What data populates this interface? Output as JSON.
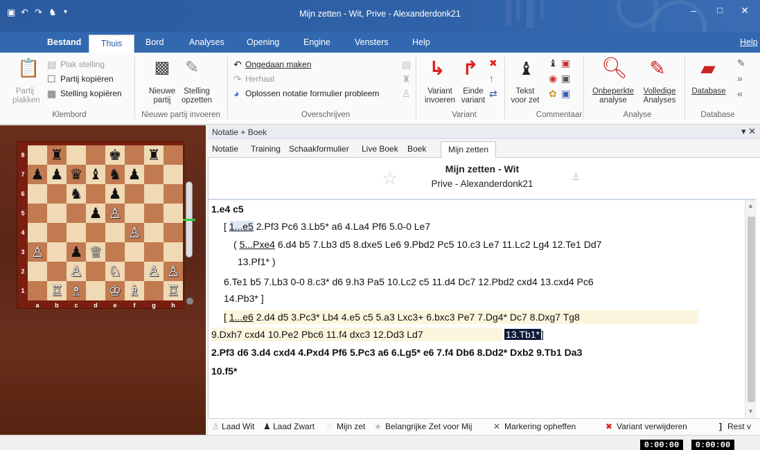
{
  "window": {
    "title": "Mijn zetten - Wit, Prive - Alexanderdonk21",
    "controls": [
      "–",
      "□",
      "✕"
    ]
  },
  "ribbon_tabs": [
    "Bestand",
    "Thuis",
    "Bord",
    "Analyses",
    "Opening",
    "Engine",
    "Vensters",
    "Help"
  ],
  "ribbon_help": "Help",
  "ribbon": {
    "klembord": {
      "label": "Klembord",
      "partij_plakken": [
        "Partij",
        "plakken"
      ],
      "plak_stelling": "Plak stelling",
      "partij_kopieren": "Partij kopiëren",
      "stelling_kopieren": "Stelling kopiëren"
    },
    "nieuwe_partij": {
      "label": "Nieuwe partij invoeren",
      "nieuwe_partij": [
        "Nieuwe",
        "partij"
      ],
      "stelling_opzetten": [
        "Stelling",
        "opzetten"
      ]
    },
    "overschrijven": {
      "label": "Overschrijven",
      "ongedaan": "Ongedaan maken",
      "herhaal": "Herhaal",
      "oplossen": "Oplossen notatie formulier probleem"
    },
    "variant": {
      "label": "Variant",
      "variant_invoeren": [
        "Variant",
        "invoeren"
      ],
      "einde_variant": [
        "Einde",
        "variant"
      ]
    },
    "commentaar": {
      "label": "Commentaar",
      "tekst_voor_zet": [
        "Tekst",
        "voor zet"
      ]
    },
    "analyse": {
      "label": "Analyse",
      "onbeperkte": [
        "Onbeperkte",
        "analyse"
      ],
      "volledige": [
        "Volledige",
        "Analyses"
      ]
    },
    "database": {
      "label": "Database",
      "database": "Database"
    }
  },
  "board": {
    "ranks": [
      "8",
      "7",
      "6",
      "5",
      "4",
      "3",
      "2",
      "1"
    ],
    "files": [
      "a",
      "b",
      "c",
      "d",
      "e",
      "f",
      "g",
      "h"
    ],
    "position": [
      [
        "",
        "♜",
        "",
        "",
        "♚",
        "",
        "♜",
        ""
      ],
      [
        "♟",
        "♟",
        "♛",
        "♝",
        "♞",
        "♟",
        "",
        ""
      ],
      [
        "",
        "",
        "♞",
        "",
        "♟",
        "",
        "",
        ""
      ],
      [
        "",
        "",
        "",
        "♟",
        "♙",
        "",
        "",
        ""
      ],
      [
        "",
        "",
        "",
        "",
        "",
        "♙",
        "",
        ""
      ],
      [
        "♙",
        "",
        "♟",
        "♕",
        "",
        "",
        "",
        ""
      ],
      [
        "",
        "",
        "♙",
        "",
        "♘",
        "",
        "♙",
        "♙"
      ],
      [
        "",
        "♖",
        "♗",
        "",
        "♔",
        "♗",
        "",
        "♖"
      ]
    ],
    "eval_fraction": 0.5
  },
  "notation_panel": {
    "title": "Notatie + Boek",
    "header_controls": "▾ ✕",
    "tabs": [
      "Notatie",
      "Training",
      "Schaakformulier",
      "Live Boek",
      "Boek",
      "Mijn zetten"
    ],
    "active_tab": "Mijn zetten",
    "game_title": "Mijn zetten - Wit",
    "game_subtitle": "Prive - Alexanderdonk21"
  },
  "notation": {
    "l1": "1.e4  c5",
    "l2_open": "[ ",
    "l2_link": "1...e5",
    "l2_rest": " 2.Pf3  Pc6  3.Lb5*  a6  4.La4  Pf6  5.0-0  Le7",
    "l3_open": "( ",
    "l3_link": "5...Pxe4",
    "l3_rest": " 6.d4  b5  7.Lb3  d5  8.dxe5  Le6  9.Pbd2  Pc5  10.c3  Le7  11.Lc2  Lg4  12.Te1  Dd7",
    "l4": "13.Pf1* )",
    "l5": "6.Te1  b5  7.Lb3  0-0  8.c3*  d6  9.h3  Pa5  10.Lc2  c5  11.d4  Dc7  12.Pbd2  cxd4  13.cxd4  Pc6",
    "l6": "14.Pb3* ]",
    "l7_open": "[ ",
    "l7_link": "1...e6",
    "l7_rest": " 2.d4  d5  3.Pc3*  Lb4  4.e5  c5  5.a3  Lxc3+  6.bxc3  Pe7  7.Dg4*  Dc7  8.Dxg7  Tg8",
    "l8": "9.Dxh7  cxd4  10.Pe2  Pbc6  11.f4  dxc3  12.Dd3  Ld7",
    "l8_current": "13.Tb1*",
    "l8_close": "]",
    "l9": "2.Pf3  d6  3.d4  cxd4  4.Pxd4  Pf6  5.Pc3  a6  6.Lg5*  e6  7.f4  Db6  8.Dd2*  Dxb2  9.Tb1  Da3",
    "l10": "10.f5*"
  },
  "bottom_toolbar": [
    "Laad Wit",
    "Laad Zwart",
    "Mijn zet",
    "Belangrijke Zet voor Mij",
    "Markering opheffen",
    "Variant verwijderen",
    "Rest v"
  ],
  "clocks": [
    "0:00:00",
    "0:00:00"
  ]
}
